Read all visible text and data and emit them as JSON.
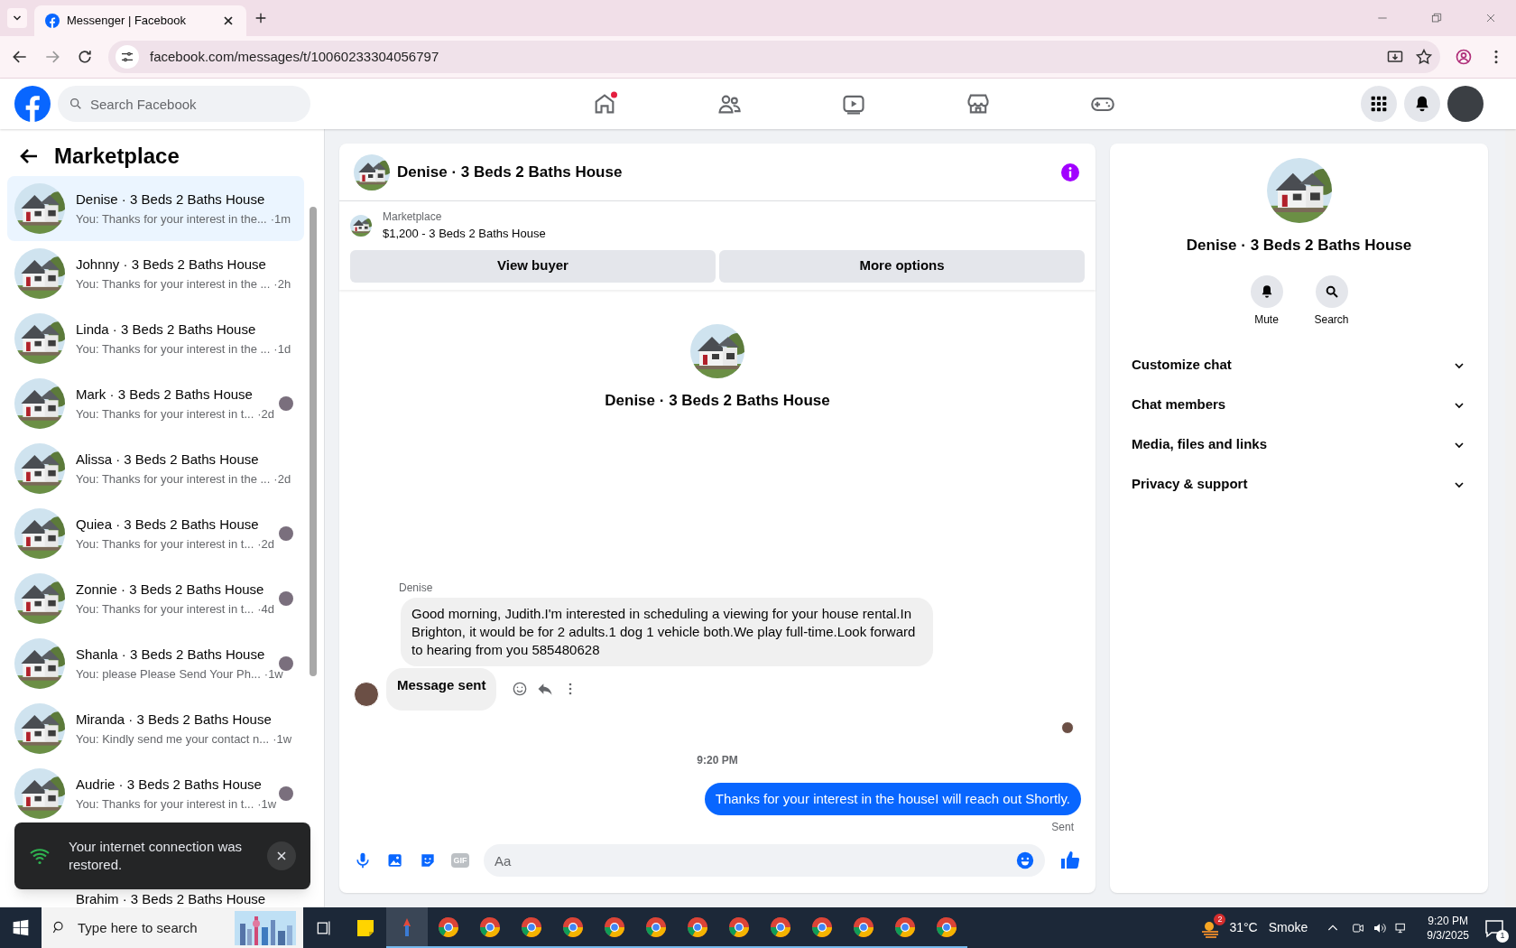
{
  "browser": {
    "tab_title": "Messenger | Facebook",
    "url": "facebook.com/messages/t/10060233304056797"
  },
  "header": {
    "search_placeholder": "Search Facebook"
  },
  "sidebar": {
    "title": "Marketplace",
    "conversations": [
      {
        "name": "Denise · 3 Beds 2 Baths House",
        "preview": "You: Thanks for your interest in the...",
        "time": "·1m",
        "selected": true,
        "seen": false
      },
      {
        "name": "Johnny · 3 Beds 2 Baths House",
        "preview": "You: Thanks for your interest in the ...",
        "time": "·2h",
        "selected": false,
        "seen": false
      },
      {
        "name": "Linda · 3 Beds 2 Baths House",
        "preview": "You: Thanks for your interest in the ...",
        "time": "·1d",
        "selected": false,
        "seen": false
      },
      {
        "name": "Mark · 3 Beds 2 Baths House",
        "preview": "You: Thanks for your interest in t...",
        "time": "·2d",
        "selected": false,
        "seen": true
      },
      {
        "name": "Alissa · 3 Beds 2 Baths House",
        "preview": "You: Thanks for your interest in the ...",
        "time": "·2d",
        "selected": false,
        "seen": false
      },
      {
        "name": "Quiea · 3 Beds 2 Baths House",
        "preview": "You: Thanks for your interest in t...",
        "time": "·2d",
        "selected": false,
        "seen": true
      },
      {
        "name": "Zonnie · 3 Beds 2 Baths House",
        "preview": "You: Thanks for your interest in t...",
        "time": "·4d",
        "selected": false,
        "seen": true
      },
      {
        "name": "Shanla · 3 Beds 2 Baths House",
        "preview": "You: please Please Send Your Ph...",
        "time": "·1w",
        "selected": false,
        "seen": true
      },
      {
        "name": "Miranda · 3 Beds 2 Baths House",
        "preview": "You: Kindly send me your contact n...",
        "time": "·1w",
        "selected": false,
        "seen": false
      },
      {
        "name": "Audrie · 3 Beds 2 Baths House",
        "preview": "You: Thanks for your interest in t...",
        "time": "·1w",
        "selected": false,
        "seen": true
      },
      {
        "name": "Brahim · 3 Beds 2 Baths House",
        "selected": false,
        "seen": false
      }
    ],
    "toast": {
      "text": "Your internet connection was restored."
    }
  },
  "chat": {
    "title": "Denise · 3 Beds 2 Baths House",
    "listing": {
      "label": "Marketplace",
      "price_title": "$1,200 - 3 Beds 2 Baths House"
    },
    "buttons": [
      "View buyer",
      "More options"
    ],
    "profile_name": "Denise · 3 Beds 2 Baths House",
    "messages": [
      {
        "kind": "incoming",
        "sender": "Denise",
        "text": "Good morning, Judith.I'm interested in scheduling a viewing for your house rental.In Brighton, it would be for 2 adults.1 dog 1 vehicle both.We play full-time.Look forward to hearing from you 585480628"
      },
      {
        "kind": "incoming_bold",
        "text": "Message sent"
      },
      {
        "kind": "timestamp",
        "text": "9:20 PM"
      },
      {
        "kind": "outgoing",
        "text": "Thanks for your interest in the houseI will reach out Shortly.",
        "status": "Sent"
      }
    ],
    "composer": {
      "placeholder": "Aa",
      "gif_label": "GIF"
    }
  },
  "details": {
    "name": "Denise · 3 Beds 2 Baths House",
    "actions": [
      {
        "kind": "mute",
        "label": "Mute"
      },
      {
        "kind": "search",
        "label": "Search"
      }
    ],
    "sections": [
      {
        "label": "Customize chat",
        "expanded": false
      },
      {
        "label": "Chat members",
        "expanded": false
      },
      {
        "label": "Media, files and links",
        "expanded": false
      },
      {
        "label": "Privacy & support",
        "expanded": false
      }
    ]
  },
  "taskbar": {
    "search_placeholder": "Type here to search",
    "weather_badge": "2",
    "temperature": "31°C",
    "condition": "Smoke",
    "time": "9:20 PM",
    "date": "9/3/2025",
    "notifications": "1"
  }
}
